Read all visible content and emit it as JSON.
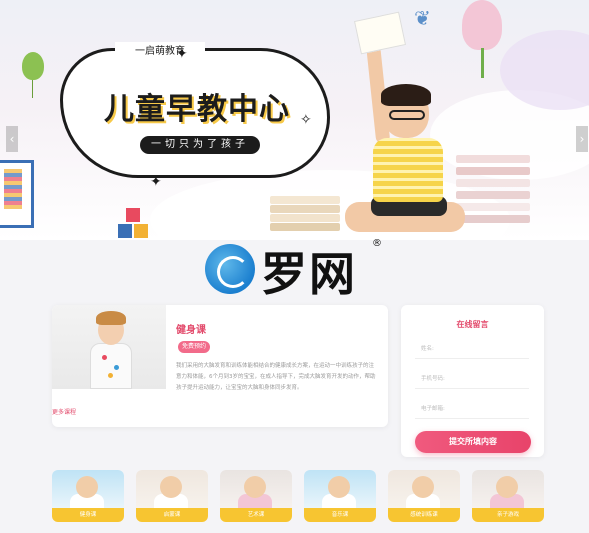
{
  "hero": {
    "brand": "一启萌教育",
    "title": "儿童早教中心",
    "tagline": "一切只为了孩子",
    "prev_icon": "chevron-left-icon",
    "next_icon": "chevron-right-icon"
  },
  "watermark": {
    "text": "罗网",
    "registered": "®"
  },
  "course": {
    "title": "健身课",
    "button": "免费预约",
    "description": "我们采用的大脑发育和训练体能相结合的健康成长方案，在运动一中训练孩子的注意力和体能，6个月到3岁的宝宝，在成人指导下，完成大脑发育开发的动作，帮助孩子提升运动能力，让宝宝的大脑和身体同步发育。",
    "more_link": "更多课程"
  },
  "form": {
    "title": "在线留言",
    "name_placeholder": "姓名:",
    "phone_placeholder": "手机号码:",
    "email_placeholder": "电子邮箱:",
    "submit": "提交所填内容"
  },
  "thumbnails": [
    {
      "label": "健身课"
    },
    {
      "label": "启蒙课"
    },
    {
      "label": "艺术课"
    },
    {
      "label": "音乐课"
    },
    {
      "label": "感统训练课"
    },
    {
      "label": "亲子游戏"
    }
  ],
  "colors": {
    "accent": "#e34b6c",
    "button_pink": "#f26b8a",
    "thumb_bar": "#f7c531"
  }
}
